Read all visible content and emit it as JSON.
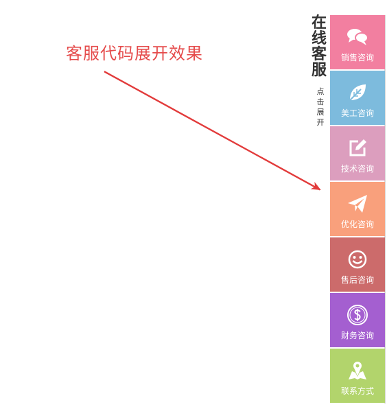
{
  "annotation": {
    "text": "客服代码展开效果",
    "color": "#e54b4b"
  },
  "sidebar": {
    "title": [
      "在",
      "线",
      "客",
      "服"
    ],
    "expand": [
      "点",
      "击",
      "展",
      "开"
    ],
    "items": [
      {
        "label": "销售咨询",
        "icon": "chat-bubbles-icon",
        "color": "#f27fa0"
      },
      {
        "label": "美工咨询",
        "icon": "leaf-icon",
        "color": "#7dbbdd"
      },
      {
        "label": "技术咨询",
        "icon": "edit-icon",
        "color": "#dc9ebe"
      },
      {
        "label": "优化咨询",
        "icon": "paper-plane-icon",
        "color": "#f9a07c"
      },
      {
        "label": "售后咨询",
        "icon": "smiley-icon",
        "color": "#cc6b6b"
      },
      {
        "label": "财务咨询",
        "icon": "dollar-icon",
        "color": "#a45fd0"
      },
      {
        "label": "联系方式",
        "icon": "map-pin-icon",
        "color": "#b2d46c"
      }
    ]
  }
}
